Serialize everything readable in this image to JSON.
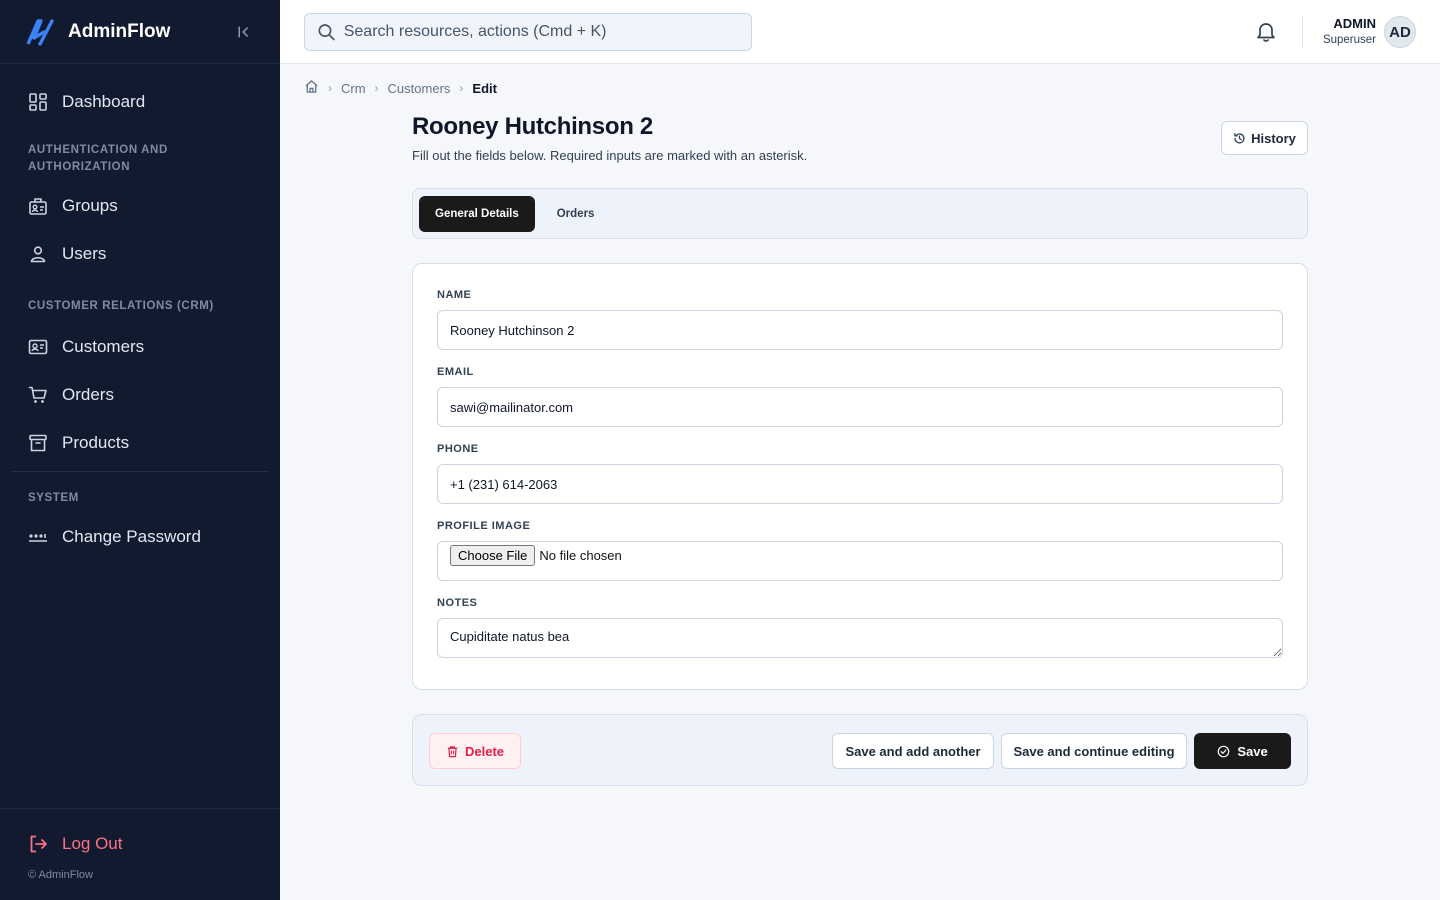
{
  "app": {
    "name": "AdminFlow",
    "logo_icon": "adminflow-logo-icon",
    "accent": "#3b82f6"
  },
  "sidebar": {
    "collapse_icon": "collapse-sidebar-icon",
    "dashboard": {
      "label": "Dashboard",
      "icon": "dashboard-icon"
    },
    "sections": {
      "auth": "AUTHENTICATION AND AUTHORIZATION",
      "crm": "CUSTOMER RELATIONS (CRM)",
      "system": "SYSTEM"
    },
    "auth_items": [
      {
        "label": "Groups",
        "icon": "groups-icon"
      },
      {
        "label": "Users",
        "icon": "user-icon"
      }
    ],
    "crm_items": [
      {
        "label": "Customers",
        "icon": "id-card-icon"
      },
      {
        "label": "Orders",
        "icon": "cart-icon"
      },
      {
        "label": "Products",
        "icon": "archive-box-icon"
      }
    ],
    "system_items": [
      {
        "label": "Change Password",
        "icon": "password-icon"
      }
    ],
    "logout": {
      "label": "Log Out",
      "icon": "logout-icon",
      "color": "#fb7185"
    },
    "copyright": "© AdminFlow"
  },
  "topbar": {
    "search_placeholder": "Search resources, actions (Cmd + K)",
    "search_icon": "search-icon",
    "bell_icon": "bell-icon",
    "user_name": "ADMIN",
    "user_role": "Superuser",
    "avatar_initials": "AD"
  },
  "breadcrumb": {
    "home_icon": "home-icon",
    "items": [
      "Crm",
      "Customers"
    ],
    "current": "Edit"
  },
  "page": {
    "title": "Rooney Hutchinson 2",
    "subtitle": "Fill out the fields below. Required inputs are marked with an asterisk.",
    "history_label": "History"
  },
  "tabs": [
    {
      "label": "General Details",
      "active": true
    },
    {
      "label": "Orders",
      "active": false
    }
  ],
  "form": {
    "name": {
      "label": "Name",
      "value": "Rooney Hutchinson 2"
    },
    "email": {
      "label": "Email",
      "value": "sawi@mailinator.com"
    },
    "phone": {
      "label": "Phone",
      "value": "+1 (231) 614-2063"
    },
    "profile_image": {
      "label": "Profile image",
      "button": "Choose File",
      "status": "No file chosen"
    },
    "notes": {
      "label": "Notes",
      "value": "Cupiditate natus bea"
    }
  },
  "actions": {
    "delete_label": "Delete",
    "save_add_label": "Save and add another",
    "save_continue_label": "Save and continue editing",
    "save_label": "Save",
    "delete_color": "#e11d48"
  }
}
